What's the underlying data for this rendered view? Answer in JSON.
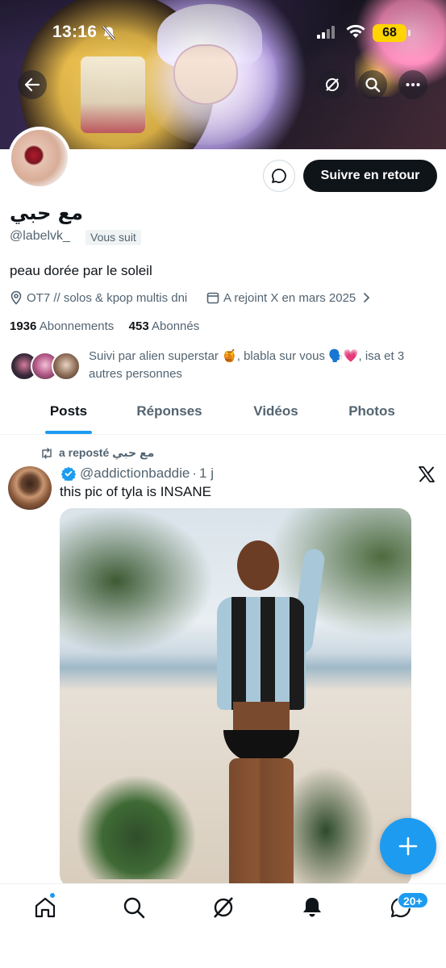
{
  "status_bar": {
    "time": "13:16",
    "battery": "68"
  },
  "header": {
    "back_icon": "arrow-left-icon",
    "grok_icon": "grok-icon",
    "search_icon": "search-icon",
    "more_icon": "more-horizontal-icon"
  },
  "profile": {
    "display_name": "مع حبي",
    "handle": "@labelvk_",
    "follows_you": "Vous suit",
    "bio": "peau dorée par le soleil",
    "location": "OT7 // solos & kpop multis dni",
    "joined": "A rejoint X en mars 2025",
    "following_count": "1936",
    "following_label": "Abonnements",
    "followers_count": "453",
    "followers_label": "Abonnés",
    "followed_by": "Suivi par alien superstar 🍯, blabla sur vous 🗣️💗, isa et 3 autres personnes",
    "follow_button": "Suivre en retour"
  },
  "tabs": [
    {
      "label": "Posts",
      "active": true
    },
    {
      "label": "Réponses",
      "active": false
    },
    {
      "label": "Vidéos",
      "active": false
    },
    {
      "label": "Photos",
      "active": false
    }
  ],
  "post": {
    "reposted_label": "a reposté مع حبي",
    "author_handle": "@addictionbaddie",
    "separator": "·",
    "age": "1 j",
    "text": "this pic of tyla is INSANE"
  },
  "bottom_nav": {
    "items": [
      "home-icon",
      "search-icon",
      "grok-icon",
      "notifications-icon",
      "messages-icon"
    ],
    "messages_badge": "20+"
  },
  "colors": {
    "accent": "#1d9bf0",
    "text": "#0f1419",
    "secondary": "#536471"
  }
}
